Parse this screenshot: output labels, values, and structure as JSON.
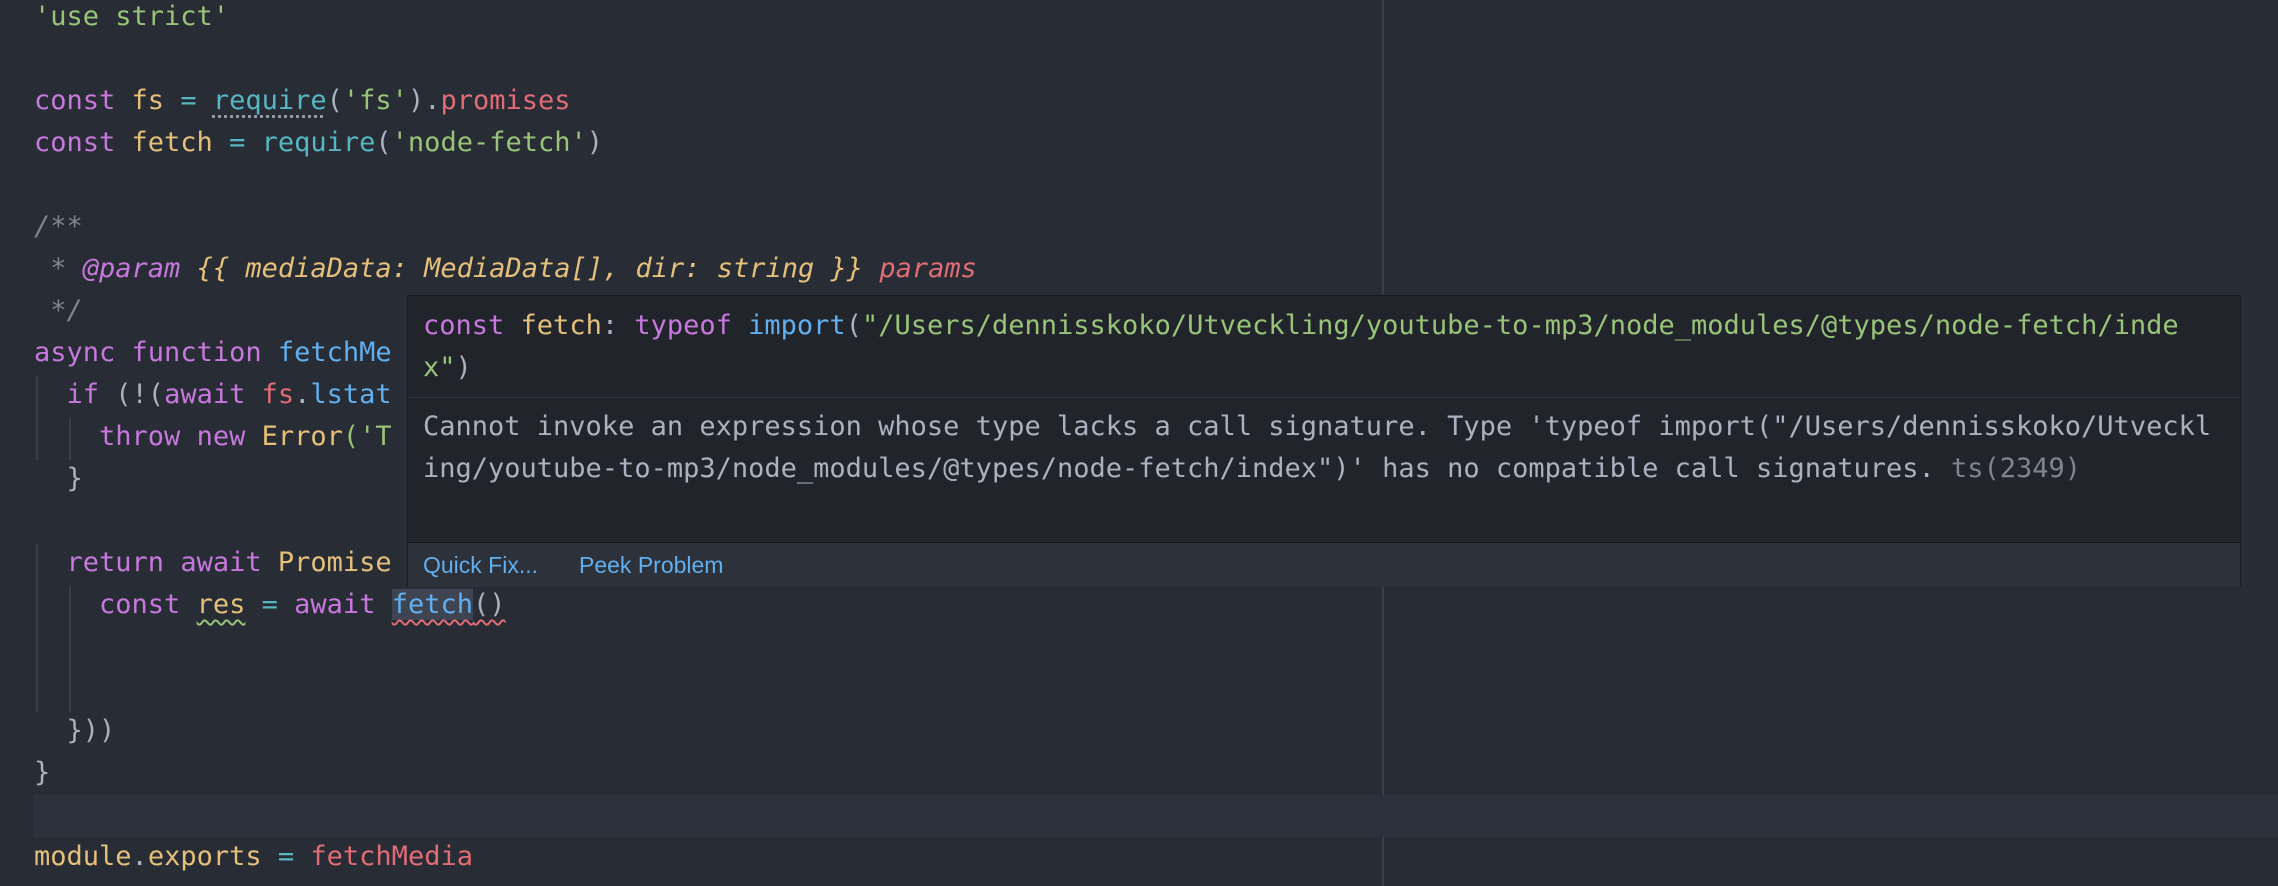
{
  "editor": {
    "lines": {
      "l1": {
        "t1": "'use strict'"
      },
      "l3": {
        "t1": "const",
        "t2": " fs ",
        "t3": "=",
        "t4": " ",
        "t5": "require",
        "t6": "(",
        "t7": "'fs'",
        "t8": ").",
        "t9": "promises"
      },
      "l4": {
        "t1": "const",
        "t2": " fetch ",
        "t3": "=",
        "t4": " ",
        "t5": "require",
        "t6": "(",
        "t7": "'node-fetch'",
        "t8": ")"
      },
      "l6": {
        "t1": "/**"
      },
      "l7": {
        "t1": " * ",
        "t2": "@param",
        "t3": " {{ mediaData: MediaData[], dir: string }} ",
        "t4": "params"
      },
      "l8": {
        "t1": " */"
      },
      "l9": {
        "t1": "async",
        "t2": " ",
        "t3": "function",
        "t4": " ",
        "t5": "fetchMe"
      },
      "l10": {
        "t1": "  ",
        "t2": "if",
        "t3": " (!(",
        "t4": "await",
        "t5": " ",
        "t6": "fs",
        "t7": ".",
        "t8": "lstat"
      },
      "l11": {
        "t1": "    ",
        "t2": "throw",
        "t3": " ",
        "t4": "new",
        "t5": " ",
        "t6": "Error",
        "t7": "('T"
      },
      "l12": {
        "t1": "  }"
      },
      "l14": {
        "t1": "  ",
        "t2": "return",
        "t3": " ",
        "t4": "await",
        "t5": " ",
        "t6": "Promise"
      },
      "l15": {
        "t1": "    ",
        "t2": "const",
        "t3": " ",
        "t4": "res",
        "t5": " ",
        "t6": "=",
        "t7": " ",
        "t8": "await",
        "t9": " ",
        "t10": "fetch",
        "t11": "()"
      },
      "l18": {
        "t1": "  }))"
      },
      "l19": {
        "t1": "}"
      },
      "l21": {
        "t1": "module",
        "t2": ".",
        "t3": "exports",
        "t4": " ",
        "t5": "=",
        "t6": " ",
        "t7": "fetchMedia"
      }
    }
  },
  "hover": {
    "sig": {
      "t1": "const",
      "t2": " ",
      "t3": "fetch",
      "t4": ": ",
      "t5": "typeof",
      "t6": " ",
      "t7": "import",
      "t8": "(",
      "t9": "\"/Users/dennisskoko/Utveckling/youtube-to-mp3/node_modules/@types/node-fetch/index\"",
      "t10": ")"
    },
    "message": "Cannot invoke an expression whose type lacks a call signature. Type 'typeof import(\"/Users/dennisskoko/Utveckling/youtube-to-mp3/node_modules/@types/node-fetch/index\")' has no compatible call signatures.",
    "code": "ts(2349)",
    "actions": {
      "quick_fix": "Quick Fix...",
      "peek_problem": "Peek Problem"
    }
  },
  "colors": {
    "background": "#282c34",
    "keyword": "#c678dd",
    "variable": "#e5c07b",
    "function": "#61afef",
    "string": "#98c379",
    "operator": "#56b6c2",
    "property": "#e06c75",
    "comment": "#7f848e",
    "hover_background": "#21252b",
    "link": "#61afef"
  }
}
